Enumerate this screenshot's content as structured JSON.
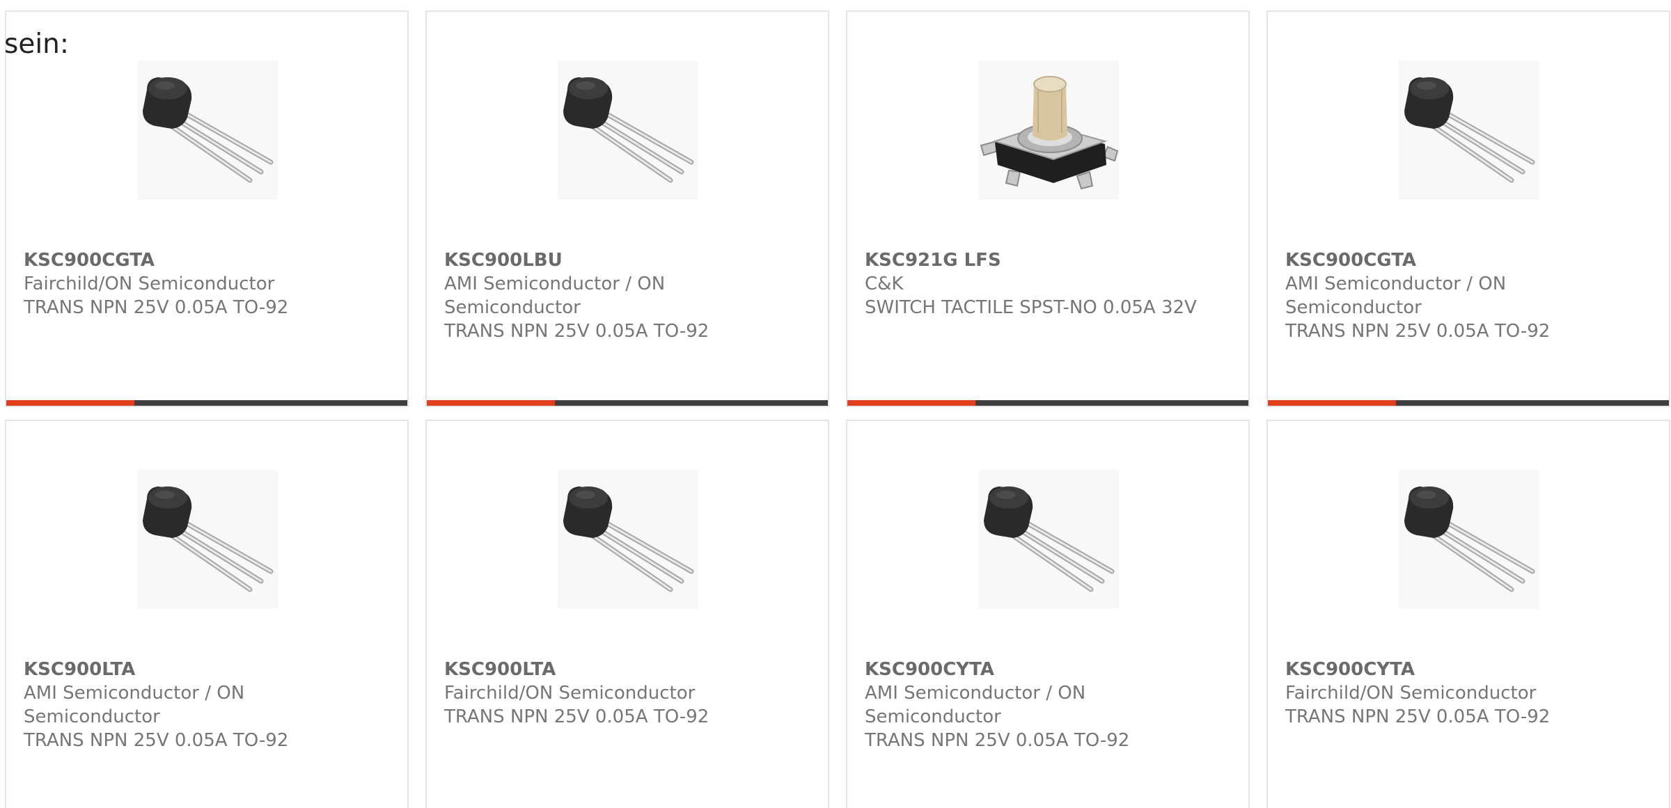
{
  "intro_text": "sein:",
  "colors": {
    "accent": "#e2401c",
    "bar_track": "#3e3e3e",
    "card_border": "#e4e4e4",
    "text": "#767676"
  },
  "products": [
    {
      "part_number": "KSC900CGTA",
      "manufacturer": "Fairchild/ON Semiconductor",
      "description": "TRANS NPN 25V 0.05A TO-92",
      "image": "to92-transistor",
      "accent_fraction": 0.32
    },
    {
      "part_number": "KSC900LBU",
      "manufacturer": "AMI Semiconductor / ON Semiconductor",
      "description": "TRANS NPN 25V 0.05A TO-92",
      "image": "to92-transistor",
      "accent_fraction": 0.32
    },
    {
      "part_number": "KSC921G LFS",
      "manufacturer": "C&K",
      "description": "SWITCH TACTILE SPST-NO 0.05A 32V",
      "image": "tactile-switch",
      "accent_fraction": 0.32
    },
    {
      "part_number": "KSC900CGTA",
      "manufacturer": "AMI Semiconductor / ON Semiconductor",
      "description": "TRANS NPN 25V 0.05A TO-92",
      "image": "to92-transistor",
      "accent_fraction": 0.32
    },
    {
      "part_number": "KSC900LTA",
      "manufacturer": "AMI Semiconductor / ON Semiconductor",
      "description": "TRANS NPN 25V 0.05A TO-92",
      "image": "to92-transistor",
      "accent_fraction": 0
    },
    {
      "part_number": "KSC900LTA",
      "manufacturer": "Fairchild/ON Semiconductor",
      "description": "TRANS NPN 25V 0.05A TO-92",
      "image": "to92-transistor",
      "accent_fraction": 0
    },
    {
      "part_number": "KSC900CYTA",
      "manufacturer": "AMI Semiconductor / ON Semiconductor",
      "description": "TRANS NPN 25V 0.05A TO-92",
      "image": "to92-transistor",
      "accent_fraction": 0
    },
    {
      "part_number": "KSC900CYTA",
      "manufacturer": "Fairchild/ON Semiconductor",
      "description": "TRANS NPN 25V 0.05A TO-92",
      "image": "to92-transistor",
      "accent_fraction": 0
    }
  ]
}
